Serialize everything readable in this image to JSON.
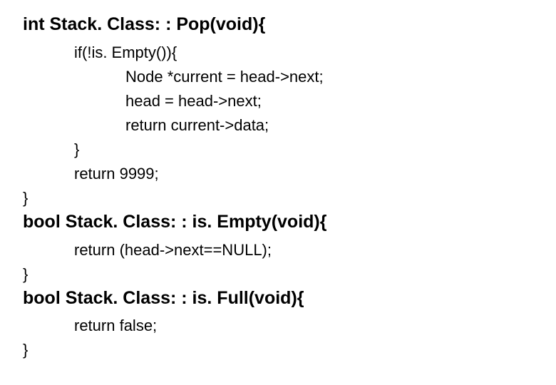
{
  "lines": {
    "sig1": "int Stack. Class: : Pop(void){",
    "l1": "if(!is. Empty()){",
    "l2": "Node *current = head->next;",
    "l3": "head = head->next;",
    "l4": "return current->data;",
    "l5": "}",
    "l6": "return 9999;",
    "l7": "}",
    "sig2": "bool Stack. Class: : is. Empty(void){",
    "l8": "return (head->next==NULL);",
    "l9": "}",
    "sig3": "bool Stack. Class: : is. Full(void){",
    "l10": "return false;",
    "l11": "}"
  }
}
